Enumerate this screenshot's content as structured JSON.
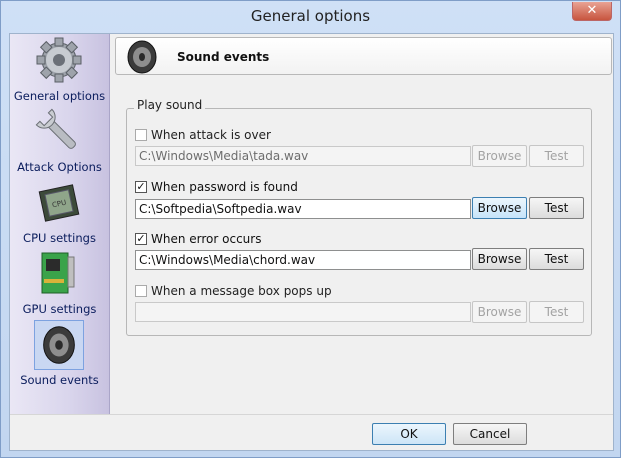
{
  "window": {
    "title": "General options",
    "close_glyph": "✕"
  },
  "sidebar": {
    "items": [
      {
        "label": "General options",
        "icon": "gear-icon"
      },
      {
        "label": "Attack Options",
        "icon": "wrench-icon"
      },
      {
        "label": "CPU settings",
        "icon": "cpu-chip-icon"
      },
      {
        "label": "GPU settings",
        "icon": "graphics-card-icon"
      },
      {
        "label": "Sound events",
        "icon": "speaker-icon",
        "selected": true
      }
    ]
  },
  "header": {
    "title": "Sound events",
    "icon": "speaker-icon"
  },
  "group": {
    "legend": "Play sound"
  },
  "events": [
    {
      "label": "When attack is over",
      "checked": false,
      "path": "C:\\Windows\\Media\\tada.wav",
      "enabled": false,
      "browse": "Browse",
      "test": "Test"
    },
    {
      "label": "When password is found",
      "checked": true,
      "path": "C:\\Softpedia\\Softpedia.wav",
      "enabled": true,
      "browse": "Browse",
      "test": "Test"
    },
    {
      "label": "When error occurs",
      "checked": true,
      "path": "C:\\Windows\\Media\\chord.wav",
      "enabled": true,
      "browse": "Browse",
      "test": "Test"
    },
    {
      "label": "When a message box pops up",
      "checked": false,
      "path": "",
      "enabled": false,
      "browse": "Browse",
      "test": "Test"
    }
  ],
  "footer": {
    "ok": "OK",
    "cancel": "Cancel"
  },
  "colors": {
    "accent": "#3c7fb1",
    "sidebar_text": "#0a1c5c",
    "close": "#c7553f"
  }
}
